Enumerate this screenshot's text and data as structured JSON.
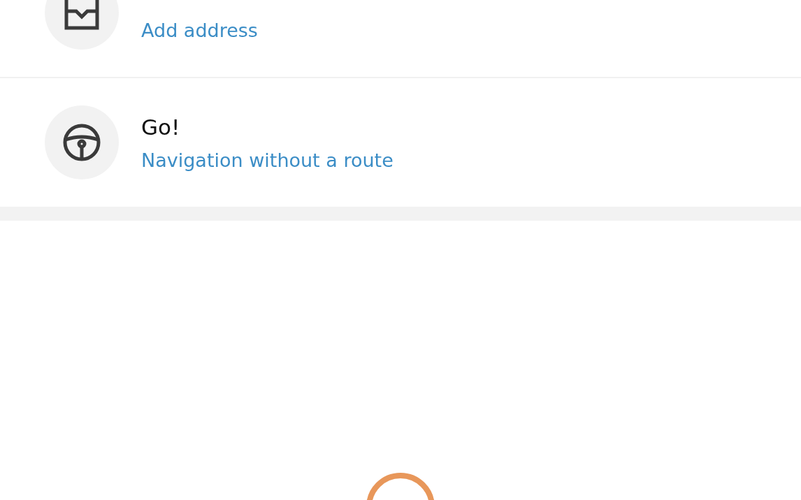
{
  "rows": [
    {
      "kind": "inbox",
      "subtitle": "Add address"
    },
    {
      "kind": "wheel",
      "title": "Go!",
      "subtitle": "Navigation without a route"
    }
  ]
}
